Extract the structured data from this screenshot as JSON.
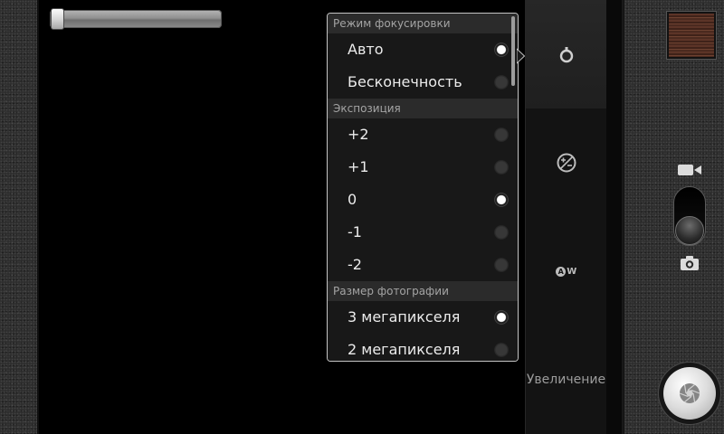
{
  "colors": {
    "viewfinder": "#000000",
    "bezel_texture": "#2e2e2e",
    "menu_background": "#181818",
    "menu_header": "#2b2b2b",
    "menu_text": "#ececec",
    "menu_header_text": "#a4a4a4",
    "menu_border": "#c4c4c4"
  },
  "zoom_slider": {
    "level": 0
  },
  "settings_popup": {
    "sections": [
      {
        "title": "Режим фокусировки",
        "options": [
          {
            "label": "Авто",
            "selected": true
          },
          {
            "label": "Бесконечность",
            "selected": false
          }
        ]
      },
      {
        "title": "Экспозиция",
        "options": [
          {
            "label": "+2",
            "selected": false
          },
          {
            "label": "+1",
            "selected": false
          },
          {
            "label": "0",
            "selected": true
          },
          {
            "label": "-1",
            "selected": false
          },
          {
            "label": "-2",
            "selected": false
          }
        ]
      },
      {
        "title": "Размер фотографии",
        "options": [
          {
            "label": "3 мегапикселя",
            "selected": true
          },
          {
            "label": "2 мегапикселя",
            "selected": false
          }
        ]
      }
    ]
  },
  "settings_column": {
    "items": [
      {
        "icon": "focus-mode-icon",
        "active": true
      },
      {
        "icon": "exposure-icon",
        "active": false
      },
      {
        "icon": "white-balance-icon",
        "glyph": [
          "A",
          "W"
        ],
        "active": false
      },
      {
        "label": "Увеличение",
        "active": false
      }
    ]
  },
  "right_panel": {
    "thumbnail": {
      "icon": "last-photo-thumbnail"
    },
    "mode_switch": {
      "video_icon": "video-camera-icon",
      "photo_icon": "camera-icon",
      "photo_mode": true
    },
    "shutter": {
      "icon": "aperture-icon"
    }
  }
}
